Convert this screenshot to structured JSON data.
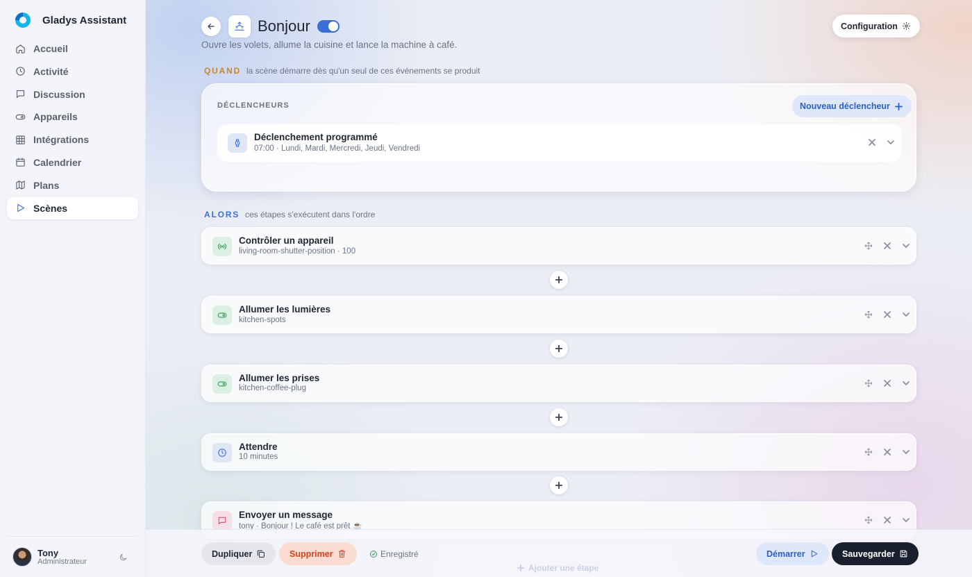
{
  "app": {
    "name": "Gladys Assistant"
  },
  "sidebar": {
    "items": [
      {
        "label": "Accueil",
        "icon": "home-icon",
        "active": false
      },
      {
        "label": "Activité",
        "icon": "clock-icon",
        "active": false
      },
      {
        "label": "Discussion",
        "icon": "chat-icon",
        "active": false
      },
      {
        "label": "Appareils",
        "icon": "toggle-icon",
        "active": false
      },
      {
        "label": "Intégrations",
        "icon": "grid-icon",
        "active": false
      },
      {
        "label": "Calendrier",
        "icon": "calendar-icon",
        "active": false
      },
      {
        "label": "Plans",
        "icon": "map-icon",
        "active": false
      },
      {
        "label": "Scènes",
        "icon": "play-icon",
        "active": true
      }
    ],
    "user": {
      "name": "Tony",
      "role": "Administrateur"
    }
  },
  "scene": {
    "title": "Bonjour",
    "enabled": true,
    "description": "Ouvre les volets, allume la cuisine et lance la machine à café.",
    "config_label": "Configuration"
  },
  "when": {
    "keyword": "QUAND",
    "hint": "la scène démarre dès qu'un seul de ces événements se produit",
    "heading": "DÉCLENCHEURS",
    "new_trigger_label": "Nouveau déclencheur",
    "triggers": [
      {
        "title": "Déclenchement programmé",
        "subtitle": "07:00 · Lundi, Mardi, Mercredi, Jeudi, Vendredi",
        "icon": "watch-icon"
      }
    ]
  },
  "then": {
    "keyword": "ALORS",
    "hint": "ces étapes s'exécutent dans l'ordre",
    "steps": [
      {
        "title": "Contrôler un appareil",
        "subtitle": "living-room-shutter-position · 100",
        "icon": "signal-icon",
        "tone": "green"
      },
      {
        "title": "Allumer les lumières",
        "subtitle": "kitchen-spots",
        "icon": "toggle-icon",
        "tone": "green"
      },
      {
        "title": "Allumer les prises",
        "subtitle": "kitchen-coffee-plug",
        "icon": "toggle-icon",
        "tone": "green"
      },
      {
        "title": "Attendre",
        "subtitle": "10 minutes",
        "icon": "clock-icon",
        "tone": "blue"
      },
      {
        "title": "Envoyer un message",
        "subtitle": "tony · Bonjour ! Le café est prêt ☕",
        "icon": "chat-icon",
        "tone": "red"
      }
    ],
    "add_step_label": "Ajouter une étape"
  },
  "footer": {
    "duplicate_label": "Dupliquer",
    "delete_label": "Supprimer",
    "saved_label": "Enregistré",
    "start_label": "Démarrer",
    "save_label": "Sauvegarder"
  },
  "colors": {
    "accent": "#3b6fd8",
    "when": "#c8862a",
    "danger": "#d4431c",
    "dark": "#1a1f2e"
  }
}
